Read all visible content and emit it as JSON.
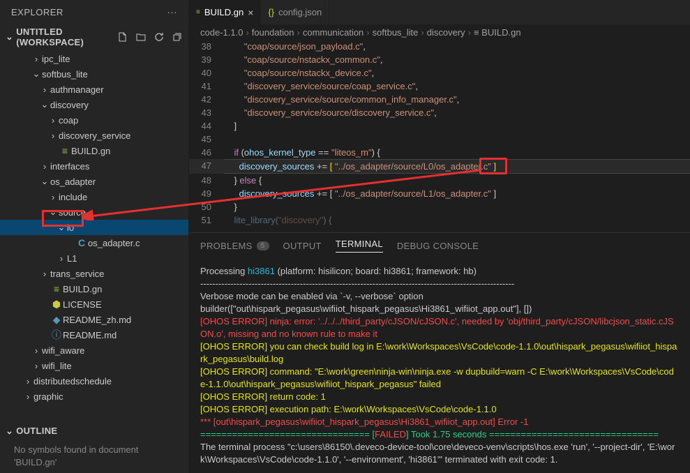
{
  "explorer": {
    "title": "EXPLORER",
    "workspace": "UNTITLED (WORKSPACE)"
  },
  "tree": [
    {
      "d": 2,
      "t": "folder-closed",
      "label": "ipc_lite"
    },
    {
      "d": 2,
      "t": "folder-open",
      "label": "softbus_lite"
    },
    {
      "d": 3,
      "t": "folder-closed",
      "label": "authmanager"
    },
    {
      "d": 3,
      "t": "folder-open",
      "label": "discovery"
    },
    {
      "d": 4,
      "t": "folder-closed",
      "label": "coap"
    },
    {
      "d": 4,
      "t": "folder-closed",
      "label": "discovery_service"
    },
    {
      "d": 4,
      "t": "gn",
      "label": "BUILD.gn"
    },
    {
      "d": 3,
      "t": "folder-closed",
      "label": "interfaces"
    },
    {
      "d": 3,
      "t": "folder-open",
      "label": "os_adapter"
    },
    {
      "d": 4,
      "t": "folder-closed",
      "label": "include"
    },
    {
      "d": 4,
      "t": "folder-open",
      "label": "source"
    },
    {
      "d": 5,
      "t": "folder-open",
      "label": "l0",
      "sel": true
    },
    {
      "d": 6,
      "t": "c",
      "label": "os_adapter.c"
    },
    {
      "d": 5,
      "t": "folder-closed",
      "label": "L1"
    },
    {
      "d": 3,
      "t": "folder-closed",
      "label": "trans_service"
    },
    {
      "d": 3,
      "t": "gn",
      "label": "BUILD.gn"
    },
    {
      "d": 3,
      "t": "lic",
      "label": "LICENSE"
    },
    {
      "d": 3,
      "t": "md",
      "label": "README_zh.md"
    },
    {
      "d": 3,
      "t": "info",
      "label": "README.md"
    },
    {
      "d": 2,
      "t": "folder-closed",
      "label": "wifi_aware"
    },
    {
      "d": 2,
      "t": "folder-closed",
      "label": "wifi_lite"
    },
    {
      "d": 1,
      "t": "folder-closed",
      "label": "distributedschedule"
    },
    {
      "d": 1,
      "t": "folder-closed",
      "label": "graphic"
    }
  ],
  "outline": {
    "header": "OUTLINE",
    "body": "No symbols found in document 'BUILD.gn'"
  },
  "tabs": [
    {
      "icon": "gn",
      "label": "BUILD.gn",
      "active": true,
      "close": true
    },
    {
      "icon": "json",
      "label": "config.json",
      "active": false,
      "close": false
    }
  ],
  "crumbs": [
    "code-1.1.0",
    "foundation",
    "communication",
    "softbus_lite",
    "discovery",
    "BUILD.gn"
  ],
  "code": [
    {
      "n": 38,
      "t": "        \"coap/source/json_payload.c\","
    },
    {
      "n": 39,
      "t": "        \"coap/source/nstackx_common.c\","
    },
    {
      "n": 40,
      "t": "        \"coap/source/nstackx_device.c\","
    },
    {
      "n": 41,
      "t": "        \"discovery_service/source/coap_service.c\","
    },
    {
      "n": 42,
      "t": "        \"discovery_service/source/common_info_manager.c\","
    },
    {
      "n": 43,
      "t": "        \"discovery_service/source/discovery_service.c\","
    },
    {
      "n": 44,
      "t": "    ]"
    },
    {
      "n": 45,
      "t": ""
    },
    {
      "n": 46,
      "t": "    if (ohos_kernel_type == \"liteos_m\") {"
    },
    {
      "n": 47,
      "t": "      discovery_sources += [ \"../os_adapter/source/L0/os_adapter.c\" ]",
      "hl": true
    },
    {
      "n": 48,
      "t": "    } else {"
    },
    {
      "n": 49,
      "t": "      discovery_sources += [ \"../os_adapter/source/L1/os_adapter.c\" ]"
    },
    {
      "n": 50,
      "t": "    }"
    },
    {
      "n": 51,
      "t": "    lite_library(\"discovery\") {",
      "dim": true
    }
  ],
  "panel": {
    "tabs": [
      {
        "label": "PROBLEMS",
        "badge": "5"
      },
      {
        "label": "OUTPUT"
      },
      {
        "label": "TERMINAL",
        "active": true
      },
      {
        "label": "DEBUG CONSOLE"
      }
    ]
  },
  "terminal": {
    "l1a": "Processing ",
    "l1b": "hi3861",
    "l1c": " (platform: hisilicon; board: hi3861; framework: hb)",
    "hr": "--------------------------------------------------------------------------------------------------------",
    "l2": "Verbose mode can be enabled via `-v, --verbose` option",
    "l3": "builder([\"out\\hispark_pegasus\\wifiiot_hispark_pegasus\\Hi3861_wifiiot_app.out\"], [])",
    "l4": "[OHOS ERROR] ninja: error: '../../../third_party/cJSON/cJSON.c', needed by 'obj/third_party/cJSON/libcjson_static.cJSON.o', missing and no known rule to make it",
    "l5": "[OHOS ERROR] you can check build log in E:\\work\\Workspaces\\VsCode\\code-1.1.0\\out\\hispark_pegasus\\wifiiot_hispark_pegasus\\build.log",
    "l6": "[OHOS ERROR] command: \"E:\\work\\green\\ninja-win\\ninja.exe -w dupbuild=warn -C E:\\work\\Workspaces\\VsCode\\code-1.1.0\\out\\hispark_pegasus\\wifiiot_hispark_pegasus\" failed",
    "l7": "[OHOS ERROR] return code: 1",
    "l8": "[OHOS ERROR] execution path: E:\\work\\Workspaces\\VsCode\\code-1.1.0",
    "l9": "*** [out\\hispark_pegasus\\wifiiot_hispark_pegasus\\Hi3861_wifiiot_app.out] Error -1",
    "l10a": "================================ [",
    "l10b": "FAILED",
    "l10c": "] Took 1.75 seconds ================================",
    "l11": "The terminal process \"c:\\users\\86150\\.deveco-device-tool\\core\\deveco-venv\\scripts\\hos.exe 'run', '--project-dir', 'E:\\work\\Workspaces\\VsCode\\code-1.1.0', '--environment', 'hi3861'\" terminated with exit code: 1."
  }
}
